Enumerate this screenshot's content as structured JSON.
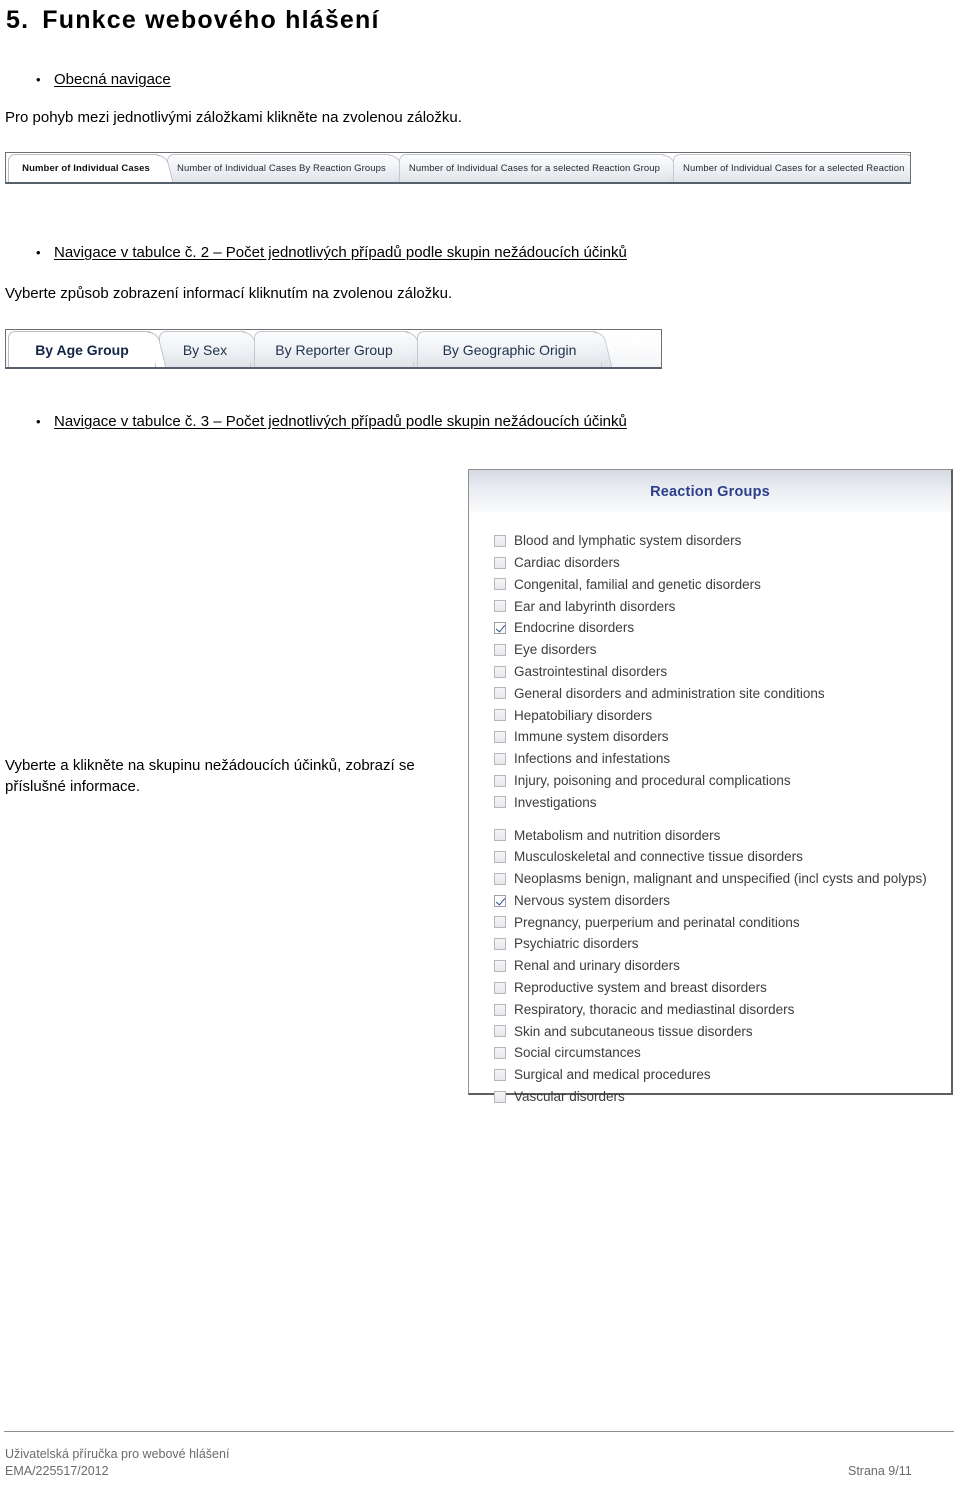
{
  "document": {
    "title_number": "5.",
    "title_text": "Funkce webového hlášení"
  },
  "sections": {
    "bullet_general_nav": "Obecná navigace",
    "para_general_nav": "Pro pohyb mezi jednotlivými záložkami klikněte na zvolenou záložku.",
    "bullet_table2": "Navigace v tabulce č. 2 – Počet jednotlivých případů podle skupin nežádoucích účinků",
    "para_table2": "Vyberte způsob zobrazení informací kliknutím na zvolenou záložku.",
    "bullet_table3": "Navigace v tabulce č. 3 – Počet jednotlivých případů podle skupin nežádoucích účinků",
    "para_table3": "Vyberte a klikněte na skupinu nežádoucích účinků, zobrazí se příslušné informace."
  },
  "tabstrip_cases": {
    "tabs": [
      {
        "label": "Number of Individual Cases",
        "active": true
      },
      {
        "label": "Number of Individual Cases By Reaction Groups",
        "active": false
      },
      {
        "label": "Number of Individual Cases for a selected Reaction Group",
        "active": false
      },
      {
        "label": "Number of Individual Cases for a selected Reaction",
        "active": false
      }
    ]
  },
  "tabstrip_breakdown": {
    "tabs": [
      {
        "label": "By Age Group",
        "active": true
      },
      {
        "label": "By Sex",
        "active": false
      },
      {
        "label": "By Reporter Group",
        "active": false
      },
      {
        "label": "By Geographic Origin",
        "active": false
      }
    ]
  },
  "reaction_groups": {
    "header": "Reaction Groups",
    "items": [
      {
        "label": "Blood and lymphatic system disorders",
        "checked": false,
        "gap_before": false
      },
      {
        "label": "Cardiac disorders",
        "checked": false,
        "gap_before": false
      },
      {
        "label": "Congenital, familial and genetic disorders",
        "checked": false,
        "gap_before": false
      },
      {
        "label": "Ear and labyrinth disorders",
        "checked": false,
        "gap_before": false
      },
      {
        "label": "Endocrine disorders",
        "checked": true,
        "gap_before": false
      },
      {
        "label": "Eye disorders",
        "checked": false,
        "gap_before": false
      },
      {
        "label": "Gastrointestinal disorders",
        "checked": false,
        "gap_before": false
      },
      {
        "label": "General disorders and administration site conditions",
        "checked": false,
        "gap_before": false
      },
      {
        "label": "Hepatobiliary disorders",
        "checked": false,
        "gap_before": false
      },
      {
        "label": "Immune system disorders",
        "checked": false,
        "gap_before": false
      },
      {
        "label": "Infections and infestations",
        "checked": false,
        "gap_before": false
      },
      {
        "label": "Injury, poisoning and procedural complications",
        "checked": false,
        "gap_before": false
      },
      {
        "label": "Investigations",
        "checked": false,
        "gap_before": false
      },
      {
        "label": "Metabolism and nutrition disorders",
        "checked": false,
        "gap_before": true
      },
      {
        "label": "Musculoskeletal and connective tissue disorders",
        "checked": false,
        "gap_before": false
      },
      {
        "label": "Neoplasms benign, malignant and unspecified (incl cysts and polyps)",
        "checked": false,
        "gap_before": false
      },
      {
        "label": "Nervous system disorders",
        "checked": true,
        "gap_before": false
      },
      {
        "label": "Pregnancy, puerperium and perinatal conditions",
        "checked": false,
        "gap_before": false
      },
      {
        "label": "Psychiatric disorders",
        "checked": false,
        "gap_before": false
      },
      {
        "label": "Renal and urinary disorders",
        "checked": false,
        "gap_before": false
      },
      {
        "label": "Reproductive system and breast disorders",
        "checked": false,
        "gap_before": false
      },
      {
        "label": "Respiratory, thoracic and mediastinal disorders",
        "checked": false,
        "gap_before": false
      },
      {
        "label": "Skin and subcutaneous tissue disorders",
        "checked": false,
        "gap_before": false
      },
      {
        "label": "Social circumstances",
        "checked": false,
        "gap_before": false
      },
      {
        "label": "Surgical and medical procedures",
        "checked": false,
        "gap_before": false
      },
      {
        "label": "Vascular disorders",
        "checked": false,
        "gap_before": false
      }
    ]
  },
  "footer": {
    "line1": "Uživatelská příručka pro webové hlášení",
    "line2": "EMA/225517/2012",
    "page": "Strana 9/11"
  },
  "colors": {
    "panel_header_text": "#2c3e8f",
    "checkbox_check": "#2b4b8c",
    "footer_text": "#6b6b6b"
  }
}
